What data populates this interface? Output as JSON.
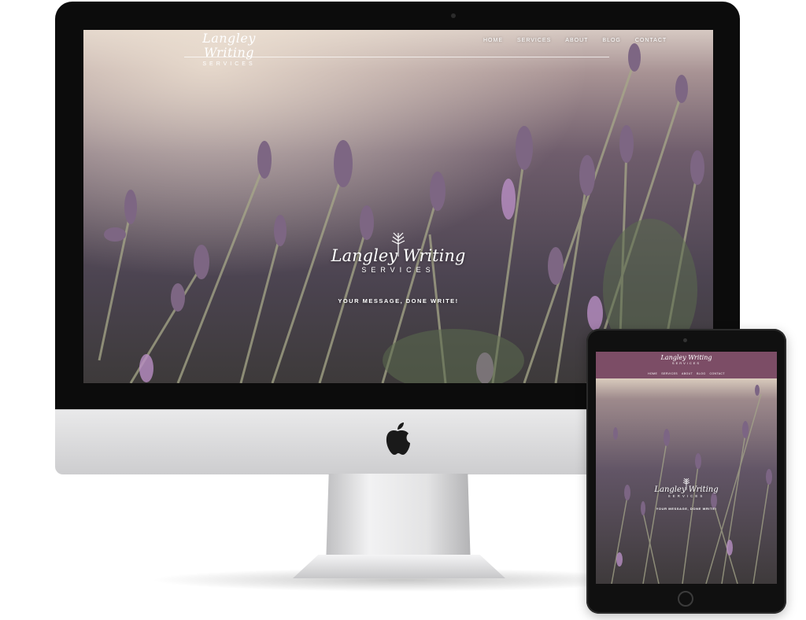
{
  "brand": {
    "script_name": "Langley Writing",
    "caps_name": "SERVICES",
    "tagline": "YOUR MESSAGE, DONE WRITE!",
    "accent_color": "#7c4d66"
  },
  "nav": {
    "items": [
      "HOME",
      "SERVICES",
      "ABOUT",
      "BLOG",
      "CONTACT"
    ]
  },
  "icons": {
    "brand_mark": "lavender-sprig-icon",
    "device_logo": "apple-logo-icon"
  }
}
